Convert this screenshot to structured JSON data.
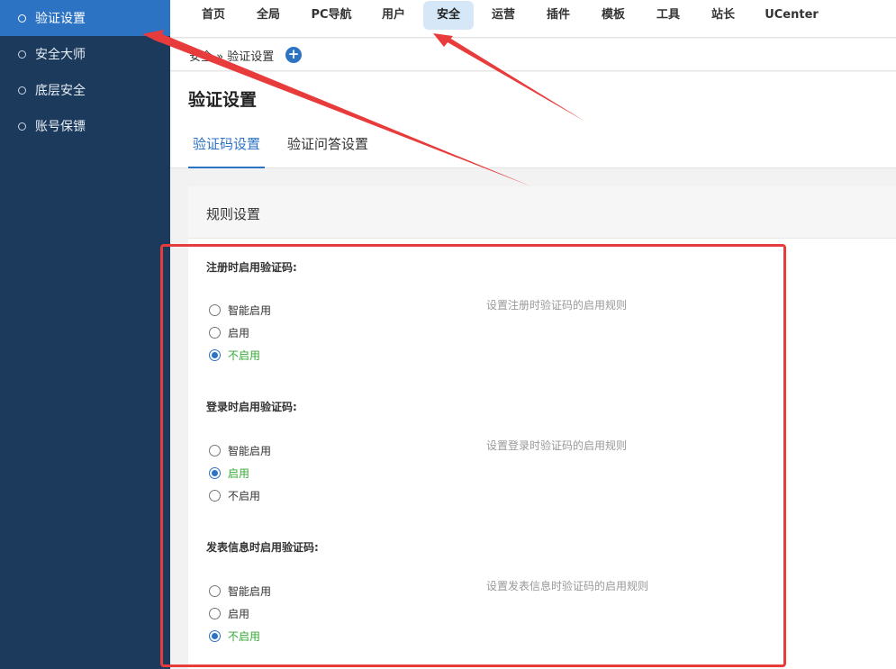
{
  "sidebar": {
    "items": [
      {
        "label": "验证设置",
        "active": true
      },
      {
        "label": "安全大师",
        "active": false
      },
      {
        "label": "底层安全",
        "active": false
      },
      {
        "label": "账号保镖",
        "active": false
      }
    ]
  },
  "topnav": {
    "items": [
      "首页",
      "全局",
      "PC导航",
      "用户",
      "安全",
      "运营",
      "插件",
      "模板",
      "工具",
      "站长",
      "UCenter"
    ],
    "active": "安全"
  },
  "breadcrumb": {
    "text": "安全 » 验证设置"
  },
  "page": {
    "title": "验证设置"
  },
  "tabs": [
    "验证码设置",
    "验证问答设置"
  ],
  "panel": {
    "title": "规则设置"
  },
  "groups": [
    {
      "label": "注册时启用验证码:",
      "hint": "设置注册时验证码的启用规则",
      "options": [
        "智能启用",
        "启用",
        "不启用"
      ],
      "selected": "不启用"
    },
    {
      "label": "登录时启用验证码:",
      "hint": "设置登录时验证码的启用规则",
      "options": [
        "智能启用",
        "启用",
        "不启用"
      ],
      "selected": "启用"
    },
    {
      "label": "发表信息时启用验证码:",
      "hint": "设置发表信息时验证码的启用规则",
      "options": [
        "智能启用",
        "启用",
        "不启用"
      ],
      "selected": "不启用"
    }
  ],
  "colors": {
    "sidebar_bg": "#1b3a5c",
    "accent": "#2d73c4",
    "active_nav_bg": "#d6e8f8",
    "checked_text": "#36a836",
    "annotation": "#e83b3b"
  }
}
